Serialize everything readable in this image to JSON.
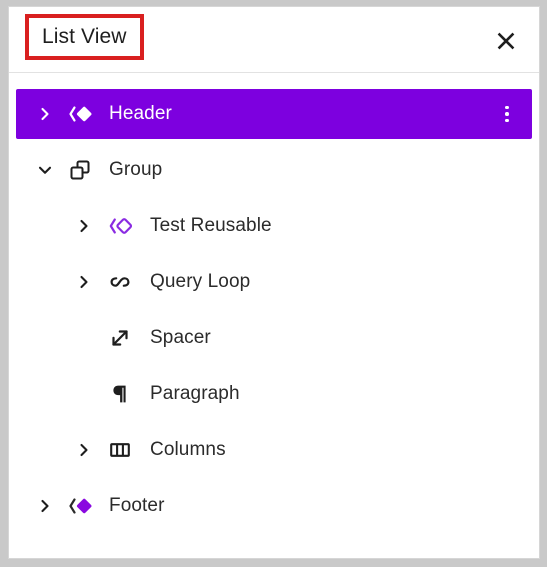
{
  "panel": {
    "title": "List View",
    "close_label": "Close",
    "close_icon": "close-icon",
    "annotation_color": "#d92020",
    "selected_color": "#7d00df"
  },
  "tree": {
    "name": "block-tree",
    "rows": [
      {
        "label": "Header",
        "icon": "template-part-icon",
        "depth": 0,
        "chevron": "chevron-right-icon",
        "expanded": false,
        "selected": true,
        "has_options": true,
        "options_icon": "more-vertical-icon"
      },
      {
        "label": "Group",
        "icon": "group-icon",
        "depth": 0,
        "chevron": "chevron-down-icon",
        "expanded": true,
        "selected": false,
        "has_options": false,
        "options_icon": ""
      },
      {
        "label": "Test Reusable",
        "icon": "reusable-block-icon",
        "depth": 1,
        "chevron": "chevron-right-icon",
        "expanded": false,
        "selected": false,
        "has_options": false,
        "options_icon": ""
      },
      {
        "label": "Query Loop",
        "icon": "loop-icon",
        "depth": 1,
        "chevron": "chevron-right-icon",
        "expanded": false,
        "selected": false,
        "has_options": false,
        "options_icon": ""
      },
      {
        "label": "Spacer",
        "icon": "spacer-icon",
        "depth": 1,
        "chevron": "",
        "expanded": false,
        "selected": false,
        "has_options": false,
        "options_icon": ""
      },
      {
        "label": "Paragraph",
        "icon": "paragraph-icon",
        "depth": 1,
        "chevron": "",
        "expanded": false,
        "selected": false,
        "has_options": false,
        "options_icon": ""
      },
      {
        "label": "Columns",
        "icon": "columns-icon",
        "depth": 1,
        "chevron": "chevron-right-icon",
        "expanded": false,
        "selected": false,
        "has_options": false,
        "options_icon": ""
      },
      {
        "label": "Footer",
        "icon": "template-part-icon",
        "depth": 0,
        "chevron": "chevron-right-icon",
        "expanded": false,
        "selected": false,
        "has_options": false,
        "options_icon": ""
      }
    ]
  }
}
